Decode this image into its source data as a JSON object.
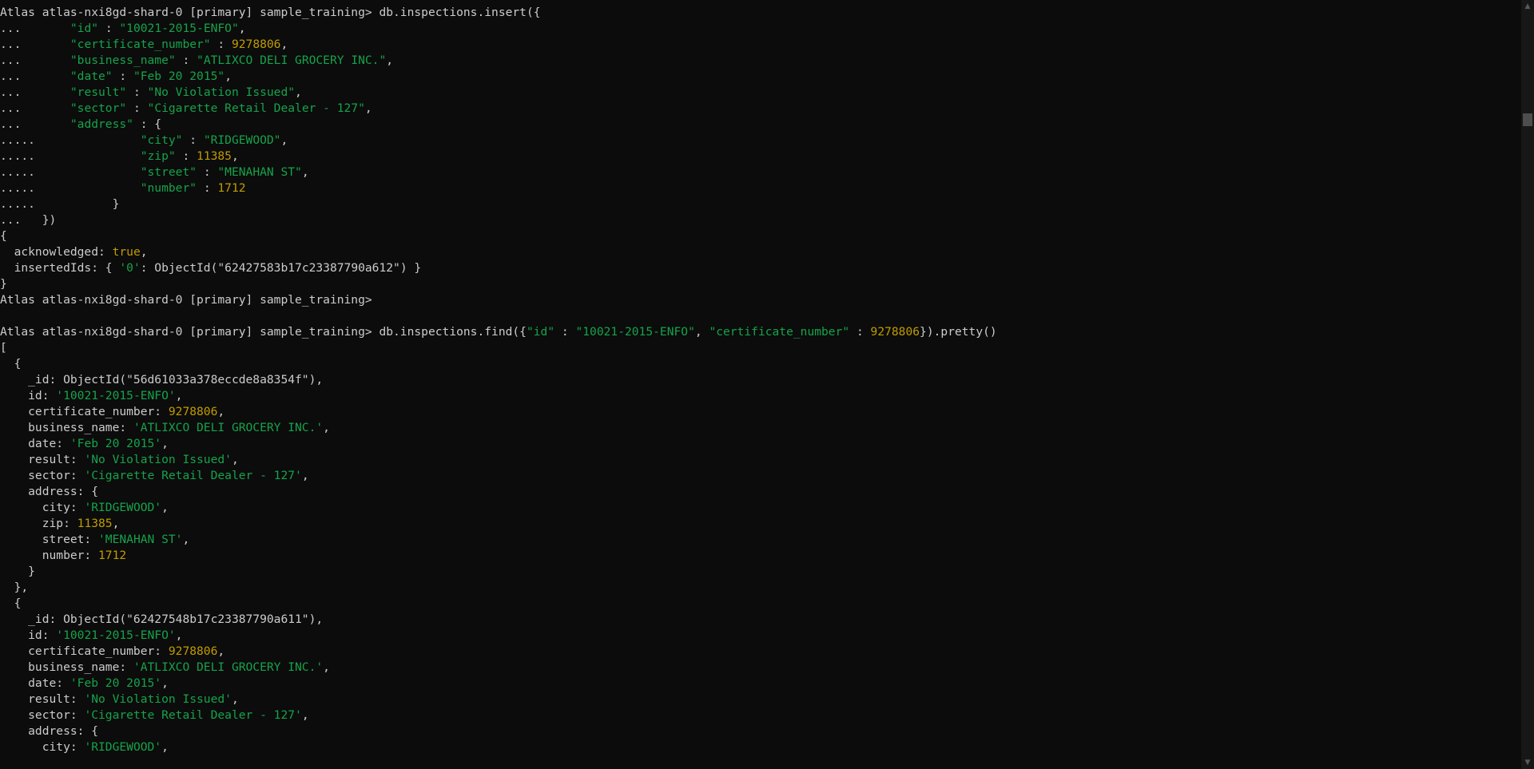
{
  "terminal": {
    "lines": [
      [
        {
          "t": "Atlas atlas-nxi8gd-shard-0 [primary] sample_training> db.inspections.insert({",
          "c": "default"
        }
      ],
      [
        {
          "t": "...       ",
          "c": "default"
        },
        {
          "t": "\"id\"",
          "c": "string"
        },
        {
          "t": " : ",
          "c": "default"
        },
        {
          "t": "\"10021-2015-ENFO\"",
          "c": "string"
        },
        {
          "t": ",",
          "c": "default"
        }
      ],
      [
        {
          "t": "...       ",
          "c": "default"
        },
        {
          "t": "\"certificate_number\"",
          "c": "string"
        },
        {
          "t": " : ",
          "c": "default"
        },
        {
          "t": "9278806",
          "c": "number"
        },
        {
          "t": ",",
          "c": "default"
        }
      ],
      [
        {
          "t": "...       ",
          "c": "default"
        },
        {
          "t": "\"business_name\"",
          "c": "string"
        },
        {
          "t": " : ",
          "c": "default"
        },
        {
          "t": "\"ATLIXCO DELI GROCERY INC.\"",
          "c": "string"
        },
        {
          "t": ",",
          "c": "default"
        }
      ],
      [
        {
          "t": "...       ",
          "c": "default"
        },
        {
          "t": "\"date\"",
          "c": "string"
        },
        {
          "t": " : ",
          "c": "default"
        },
        {
          "t": "\"Feb 20 2015\"",
          "c": "string"
        },
        {
          "t": ",",
          "c": "default"
        }
      ],
      [
        {
          "t": "...       ",
          "c": "default"
        },
        {
          "t": "\"result\"",
          "c": "string"
        },
        {
          "t": " : ",
          "c": "default"
        },
        {
          "t": "\"No Violation Issued\"",
          "c": "string"
        },
        {
          "t": ",",
          "c": "default"
        }
      ],
      [
        {
          "t": "...       ",
          "c": "default"
        },
        {
          "t": "\"sector\"",
          "c": "string"
        },
        {
          "t": " : ",
          "c": "default"
        },
        {
          "t": "\"Cigarette Retail Dealer - 127\"",
          "c": "string"
        },
        {
          "t": ",",
          "c": "default"
        }
      ],
      [
        {
          "t": "...       ",
          "c": "default"
        },
        {
          "t": "\"address\"",
          "c": "string"
        },
        {
          "t": " : {",
          "c": "default"
        }
      ],
      [
        {
          "t": ".....               ",
          "c": "default"
        },
        {
          "t": "\"city\"",
          "c": "string"
        },
        {
          "t": " : ",
          "c": "default"
        },
        {
          "t": "\"RIDGEWOOD\"",
          "c": "string"
        },
        {
          "t": ",",
          "c": "default"
        }
      ],
      [
        {
          "t": ".....               ",
          "c": "default"
        },
        {
          "t": "\"zip\"",
          "c": "string"
        },
        {
          "t": " : ",
          "c": "default"
        },
        {
          "t": "11385",
          "c": "number"
        },
        {
          "t": ",",
          "c": "default"
        }
      ],
      [
        {
          "t": ".....               ",
          "c": "default"
        },
        {
          "t": "\"street\"",
          "c": "string"
        },
        {
          "t": " : ",
          "c": "default"
        },
        {
          "t": "\"MENAHAN ST\"",
          "c": "string"
        },
        {
          "t": ",",
          "c": "default"
        }
      ],
      [
        {
          "t": ".....               ",
          "c": "default"
        },
        {
          "t": "\"number\"",
          "c": "string"
        },
        {
          "t": " : ",
          "c": "default"
        },
        {
          "t": "1712",
          "c": "number"
        }
      ],
      [
        {
          "t": ".....           }",
          "c": "default"
        }
      ],
      [
        {
          "t": "...   })",
          "c": "default"
        }
      ],
      [
        {
          "t": "{",
          "c": "default"
        }
      ],
      [
        {
          "t": "  acknowledged: ",
          "c": "default"
        },
        {
          "t": "true",
          "c": "bool"
        },
        {
          "t": ",",
          "c": "default"
        }
      ],
      [
        {
          "t": "  insertedIds: { ",
          "c": "default"
        },
        {
          "t": "'0'",
          "c": "string"
        },
        {
          "t": ": ObjectId(\"62427583b17c23387790a612\") }",
          "c": "default"
        }
      ],
      [
        {
          "t": "}",
          "c": "default"
        }
      ],
      [
        {
          "t": "Atlas atlas-nxi8gd-shard-0 [primary] sample_training>",
          "c": "default"
        }
      ],
      [
        {
          "t": "",
          "c": "default"
        }
      ],
      [
        {
          "t": "Atlas atlas-nxi8gd-shard-0 [primary] sample_training> db.inspections.find({",
          "c": "default"
        },
        {
          "t": "\"id\"",
          "c": "string"
        },
        {
          "t": " : ",
          "c": "default"
        },
        {
          "t": "\"10021-2015-ENFO\"",
          "c": "string"
        },
        {
          "t": ", ",
          "c": "default"
        },
        {
          "t": "\"certificate_number\"",
          "c": "string"
        },
        {
          "t": " : ",
          "c": "default"
        },
        {
          "t": "9278806",
          "c": "number"
        },
        {
          "t": "}).pretty()",
          "c": "default"
        }
      ],
      [
        {
          "t": "[",
          "c": "default"
        }
      ],
      [
        {
          "t": "  {",
          "c": "default"
        }
      ],
      [
        {
          "t": "    _id: ObjectId(\"56d61033a378eccde8a8354f\"),",
          "c": "default"
        }
      ],
      [
        {
          "t": "    id: ",
          "c": "default"
        },
        {
          "t": "'10021-2015-ENFO'",
          "c": "string"
        },
        {
          "t": ",",
          "c": "default"
        }
      ],
      [
        {
          "t": "    certificate_number: ",
          "c": "default"
        },
        {
          "t": "9278806",
          "c": "number"
        },
        {
          "t": ",",
          "c": "default"
        }
      ],
      [
        {
          "t": "    business_name: ",
          "c": "default"
        },
        {
          "t": "'ATLIXCO DELI GROCERY INC.'",
          "c": "string"
        },
        {
          "t": ",",
          "c": "default"
        }
      ],
      [
        {
          "t": "    date: ",
          "c": "default"
        },
        {
          "t": "'Feb 20 2015'",
          "c": "string"
        },
        {
          "t": ",",
          "c": "default"
        }
      ],
      [
        {
          "t": "    result: ",
          "c": "default"
        },
        {
          "t": "'No Violation Issued'",
          "c": "string"
        },
        {
          "t": ",",
          "c": "default"
        }
      ],
      [
        {
          "t": "    sector: ",
          "c": "default"
        },
        {
          "t": "'Cigarette Retail Dealer - 127'",
          "c": "string"
        },
        {
          "t": ",",
          "c": "default"
        }
      ],
      [
        {
          "t": "    address: {",
          "c": "default"
        }
      ],
      [
        {
          "t": "      city: ",
          "c": "default"
        },
        {
          "t": "'RIDGEWOOD'",
          "c": "string"
        },
        {
          "t": ",",
          "c": "default"
        }
      ],
      [
        {
          "t": "      zip: ",
          "c": "default"
        },
        {
          "t": "11385",
          "c": "number"
        },
        {
          "t": ",",
          "c": "default"
        }
      ],
      [
        {
          "t": "      street: ",
          "c": "default"
        },
        {
          "t": "'MENAHAN ST'",
          "c": "string"
        },
        {
          "t": ",",
          "c": "default"
        }
      ],
      [
        {
          "t": "      number: ",
          "c": "default"
        },
        {
          "t": "1712",
          "c": "number"
        }
      ],
      [
        {
          "t": "    }",
          "c": "default"
        }
      ],
      [
        {
          "t": "  },",
          "c": "default"
        }
      ],
      [
        {
          "t": "  {",
          "c": "default"
        }
      ],
      [
        {
          "t": "    _id: ObjectId(\"62427548b17c23387790a611\"),",
          "c": "default"
        }
      ],
      [
        {
          "t": "    id: ",
          "c": "default"
        },
        {
          "t": "'10021-2015-ENFO'",
          "c": "string"
        },
        {
          "t": ",",
          "c": "default"
        }
      ],
      [
        {
          "t": "    certificate_number: ",
          "c": "default"
        },
        {
          "t": "9278806",
          "c": "number"
        },
        {
          "t": ",",
          "c": "default"
        }
      ],
      [
        {
          "t": "    business_name: ",
          "c": "default"
        },
        {
          "t": "'ATLIXCO DELI GROCERY INC.'",
          "c": "string"
        },
        {
          "t": ",",
          "c": "default"
        }
      ],
      [
        {
          "t": "    date: ",
          "c": "default"
        },
        {
          "t": "'Feb 20 2015'",
          "c": "string"
        },
        {
          "t": ",",
          "c": "default"
        }
      ],
      [
        {
          "t": "    result: ",
          "c": "default"
        },
        {
          "t": "'No Violation Issued'",
          "c": "string"
        },
        {
          "t": ",",
          "c": "default"
        }
      ],
      [
        {
          "t": "    sector: ",
          "c": "default"
        },
        {
          "t": "'Cigarette Retail Dealer - 127'",
          "c": "string"
        },
        {
          "t": ",",
          "c": "default"
        }
      ],
      [
        {
          "t": "    address: {",
          "c": "default"
        }
      ],
      [
        {
          "t": "      city: ",
          "c": "default"
        },
        {
          "t": "'RIDGEWOOD'",
          "c": "string"
        },
        {
          "t": ",",
          "c": "default"
        }
      ]
    ]
  },
  "scrollbar": {
    "up_icon": "scroll-up-arrow-icon",
    "down_icon": "scroll-down-arrow-icon",
    "up_glyph": "▲",
    "down_glyph": "▼"
  },
  "colors": {
    "background": "#0c0c0c",
    "default_text": "#cccccc",
    "string": "#16a34a",
    "number": "#c19c00"
  }
}
